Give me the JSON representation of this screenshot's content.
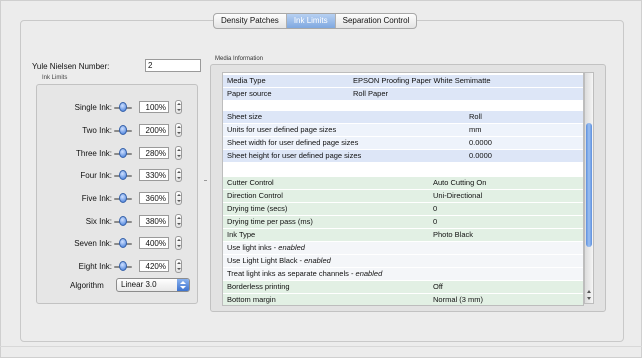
{
  "tabs": [
    {
      "label": "Density Patches",
      "active": false
    },
    {
      "label": "Ink Limits",
      "active": true
    },
    {
      "label": "Separation Control",
      "active": false
    }
  ],
  "yule_nielsen": {
    "label": "Yule Nielsen Number:",
    "value": "2"
  },
  "ink_limits": {
    "title": "Ink Limits",
    "rows": [
      {
        "label": "Single Ink:",
        "value": "100%"
      },
      {
        "label": "Two Ink:",
        "value": "200%"
      },
      {
        "label": "Three Ink:",
        "value": "280%"
      },
      {
        "label": "Four Ink:",
        "value": "330%"
      },
      {
        "label": "Five Ink:",
        "value": "360%"
      },
      {
        "label": "Six Ink:",
        "value": "380%"
      },
      {
        "label": "Seven Ink:",
        "value": "400%"
      },
      {
        "label": "Eight Ink:",
        "value": "420%"
      }
    ],
    "algorithm_label": "Algorithm",
    "algorithm_value": "Linear 3.0"
  },
  "media_info": {
    "title": "Media Information",
    "rows": [
      {
        "key": "Media Type",
        "value": "EPSON Proofing Paper White Semimatte",
        "style": "c1"
      },
      {
        "key": "Paper source",
        "value": "Roll Paper",
        "style": "c1"
      },
      {
        "key": "Sheet size",
        "value": "Roll",
        "style": "c1"
      },
      {
        "key": "Units for user defined page sizes",
        "value": "mm",
        "style": "c0"
      },
      {
        "key": "Sheet width for user defined page sizes",
        "value": "0.0000",
        "style": "c0"
      },
      {
        "key": "Sheet height for user defined page sizes",
        "value": "0.0000",
        "style": "c1"
      },
      {
        "key": "Cutter Control",
        "value": "Auto Cutting On",
        "style": "c2"
      },
      {
        "key": "Direction Control",
        "value": "Uni-Directional",
        "style": "c2"
      },
      {
        "key": "Drying time (secs)",
        "value": "0",
        "style": "c2"
      },
      {
        "key": "Drying time per pass (ms)",
        "value": "0",
        "style": "c2"
      },
      {
        "key": "Ink Type",
        "value": "Photo Black",
        "style": "c2"
      },
      {
        "key": "Use light inks - ",
        "emph": "enabled",
        "value": "",
        "style": "c3"
      },
      {
        "key": "Use Light Light Black - ",
        "emph": "enabled",
        "value": "",
        "style": "c3"
      },
      {
        "key": "Treat light inks as separate channels - ",
        "emph": "enabled",
        "value": "",
        "style": "c3"
      },
      {
        "key": "Borderless printing",
        "value": "Off",
        "style": "c2"
      },
      {
        "key": "Bottom margin",
        "value": "Normal (3 mm)",
        "style": "c2"
      }
    ]
  }
}
